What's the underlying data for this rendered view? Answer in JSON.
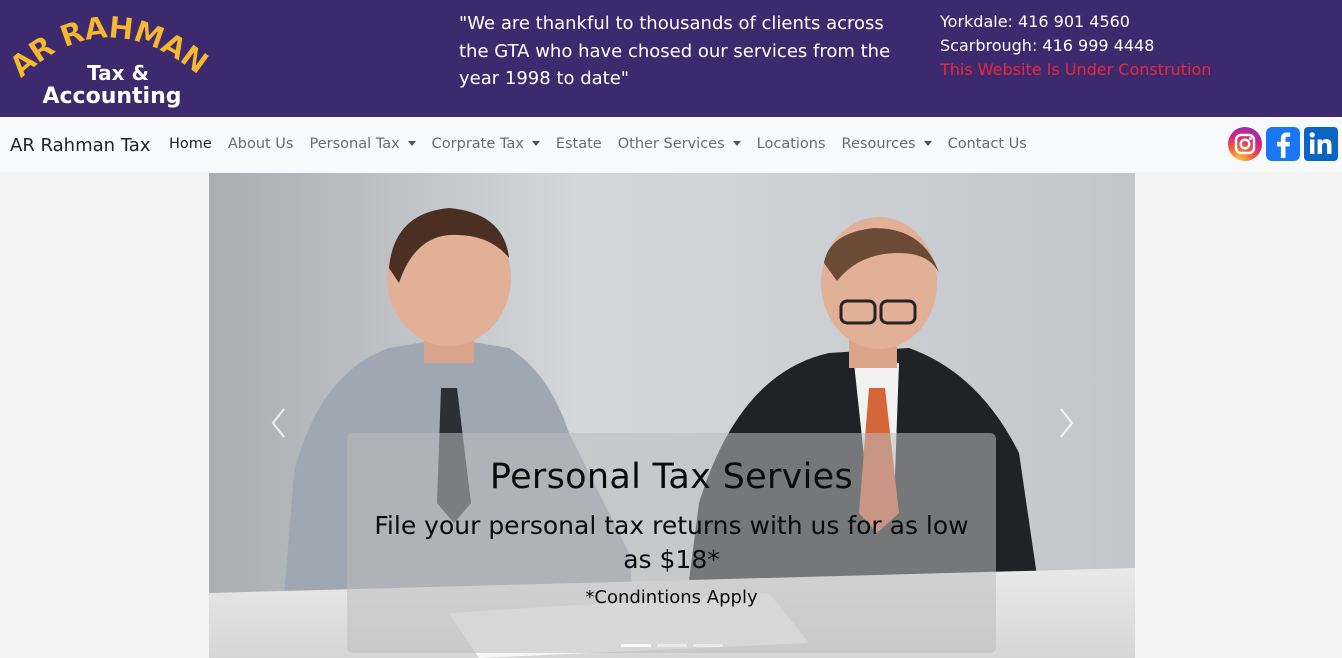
{
  "header": {
    "logo": {
      "line1": "AR RAHMAN",
      "line2": "Tax &",
      "line3": "Accounting"
    },
    "tagline": "\"We are thankful to thousands of clients across the GTA who have chosed our services from the year 1998 to date\"",
    "contact": {
      "yorkdale": "Yorkdale: 416 901 4560",
      "scarbrough": "Scarbrough: 416 999 4448",
      "notice": "This Website Is Under Constrution"
    }
  },
  "navbar": {
    "brand": "AR Rahman Tax",
    "items": [
      {
        "label": "Home",
        "dropdown": false,
        "active": true
      },
      {
        "label": "About Us",
        "dropdown": false
      },
      {
        "label": "Personal Tax",
        "dropdown": true
      },
      {
        "label": "Corprate Tax",
        "dropdown": true
      },
      {
        "label": "Estate",
        "dropdown": false
      },
      {
        "label": "Other Services",
        "dropdown": true
      },
      {
        "label": "Locations",
        "dropdown": false
      },
      {
        "label": "Resources",
        "dropdown": true
      },
      {
        "label": "Contact Us",
        "dropdown": false
      }
    ],
    "socials": [
      "instagram-icon",
      "facebook-icon",
      "linkedin-icon"
    ]
  },
  "carousel": {
    "title": "Personal Tax Servies",
    "subtitle": "File your personal tax returns with us for as low as $18*",
    "note": "*Condintions Apply",
    "slides": 3,
    "active_slide": 1
  },
  "colors": {
    "header_bg": "#3d2a6e",
    "logo_gold": "#f5b82e",
    "notice_red": "#e8283a",
    "navbar_bg": "#f8f9fa"
  }
}
